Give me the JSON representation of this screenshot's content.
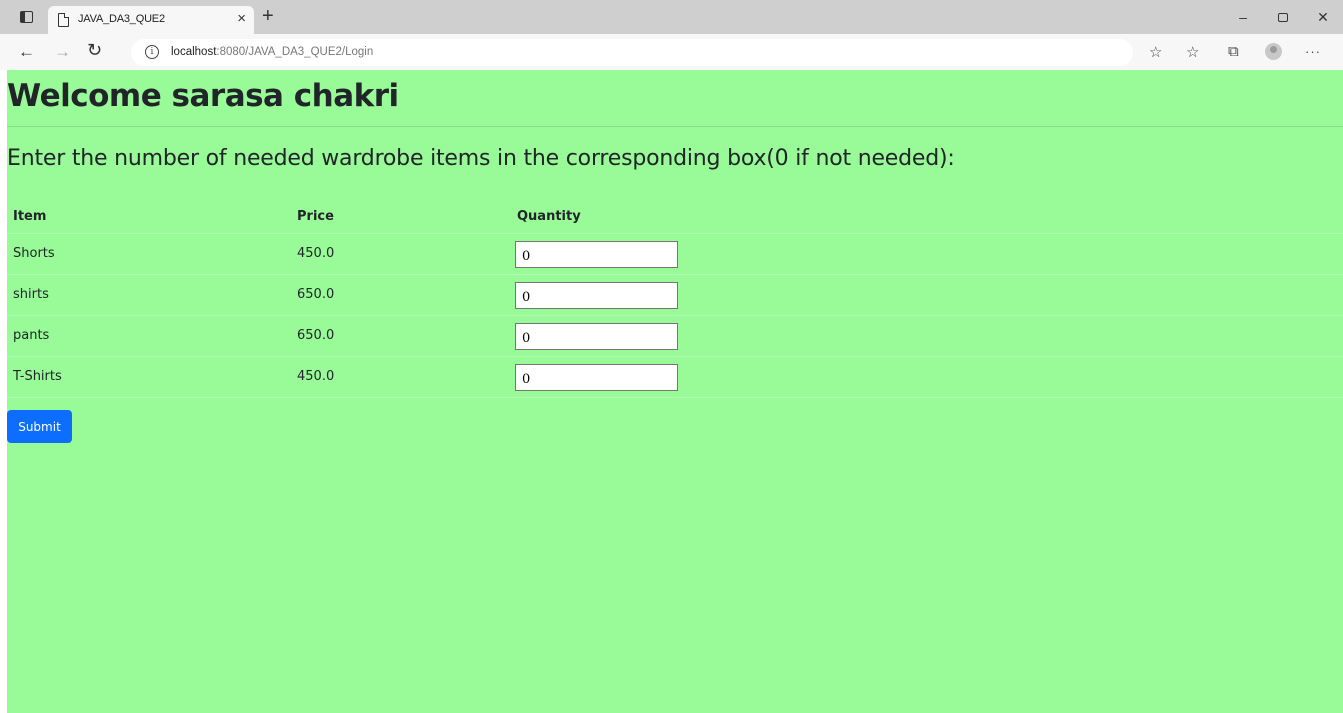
{
  "browser": {
    "tab_title": "JAVA_DA3_QUE2",
    "tab_close": "×",
    "new_tab": "+",
    "url_host": "localhost",
    "url_path": ":8080/JAVA_DA3_QUE2/Login",
    "window_controls": {
      "minimize": "–",
      "close": "✕"
    },
    "more": "···"
  },
  "page": {
    "welcome": "Welcome sarasa chakri",
    "instruction": "Enter the number of needed wardrobe items in the corresponding box(0 if not needed):",
    "table": {
      "headers": [
        "Item",
        "Price",
        "Quantity"
      ],
      "rows": [
        {
          "item": "Shorts",
          "price": "450.0",
          "quantity": "0"
        },
        {
          "item": "shirts",
          "price": "650.0",
          "quantity": "0"
        },
        {
          "item": "pants",
          "price": "650.0",
          "quantity": "0"
        },
        {
          "item": "T-Shirts",
          "price": "450.0",
          "quantity": "0"
        }
      ]
    },
    "submit_label": "Submit"
  },
  "colors": {
    "page_background": "#98fb98",
    "submit_button": "#0d6efd"
  }
}
